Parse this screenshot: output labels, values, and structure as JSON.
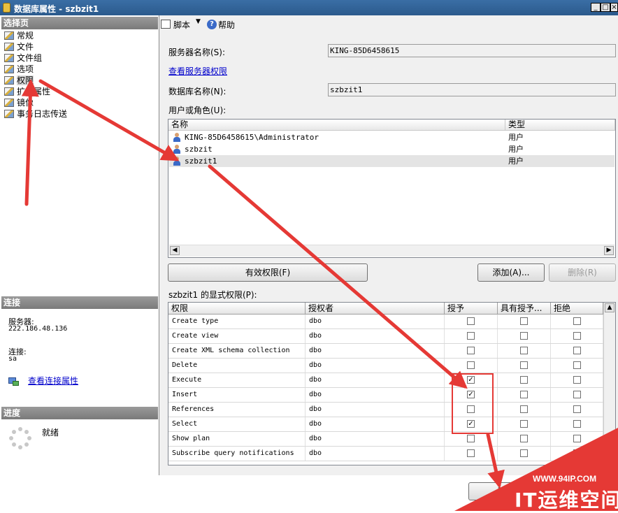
{
  "window": {
    "title": "数据库属性 - szbzit1"
  },
  "left": {
    "select_page_header": "选择页",
    "nav_items": [
      {
        "label": "常规"
      },
      {
        "label": "文件"
      },
      {
        "label": "文件组"
      },
      {
        "label": "选项"
      },
      {
        "label": "权限"
      },
      {
        "label": "扩展属性"
      },
      {
        "label": "镜像"
      },
      {
        "label": "事务日志传送"
      }
    ],
    "connection_header": "连接",
    "server_label": "服务器:",
    "server_value": "222.186.48.136",
    "conn_label": "连接:",
    "conn_value": "sa",
    "view_conn_props": "查看连接属性",
    "progress_header": "进度",
    "progress_status": "就绪"
  },
  "toolbar": {
    "script": "脚本",
    "help": "帮助"
  },
  "form": {
    "server_name_label": "服务器名称(S):",
    "server_name_value": "KING-85D6458615",
    "view_server_perms": "查看服务器权限",
    "db_name_label": "数据库名称(N):",
    "db_name_value": "szbzit1",
    "users_roles_label": "用户或角色(U):"
  },
  "users": {
    "columns": [
      "名称",
      "类型"
    ],
    "rows": [
      {
        "name": "KING-85D6458615\\Administrator",
        "type": "用户"
      },
      {
        "name": "szbzit",
        "type": "用户"
      },
      {
        "name": "szbzit1",
        "type": "用户"
      }
    ]
  },
  "buttons": {
    "effective": "有效权限(F)",
    "add": "添加(A)...",
    "remove": "删除(R)"
  },
  "explicit_label": "szbzit1 的显式权限(P):",
  "perms": {
    "columns": [
      "权限",
      "授权者",
      "授予",
      "具有授予...",
      "拒绝"
    ],
    "rows": [
      {
        "perm": "Create type",
        "grantor": "dbo",
        "grant": false,
        "with_grant": false,
        "deny": false
      },
      {
        "perm": "Create view",
        "grantor": "dbo",
        "grant": false,
        "with_grant": false,
        "deny": false
      },
      {
        "perm": "Create XML schema collection",
        "grantor": "dbo",
        "grant": false,
        "with_grant": false,
        "deny": false
      },
      {
        "perm": "Delete",
        "grantor": "dbo",
        "grant": false,
        "with_grant": false,
        "deny": false
      },
      {
        "perm": "Execute",
        "grantor": "dbo",
        "grant": true,
        "with_grant": false,
        "deny": false
      },
      {
        "perm": "Insert",
        "grantor": "dbo",
        "grant": true,
        "with_grant": false,
        "deny": false
      },
      {
        "perm": "References",
        "grantor": "dbo",
        "grant": false,
        "with_grant": false,
        "deny": false
      },
      {
        "perm": "Select",
        "grantor": "dbo",
        "grant": true,
        "with_grant": false,
        "deny": false
      },
      {
        "perm": "Show plan",
        "grantor": "dbo",
        "grant": false,
        "with_grant": false,
        "deny": false
      },
      {
        "perm": "Subscribe query notifications",
        "grantor": "dbo",
        "grant": false,
        "with_grant": false,
        "deny": false
      }
    ]
  },
  "ok_button": "确",
  "watermark": {
    "url": "WWW.94IP.COM",
    "text": "IT运维空间"
  },
  "colors": {
    "annotation": "#e53935",
    "title_bar": "#2b5a8c",
    "link": "#0000cc"
  }
}
